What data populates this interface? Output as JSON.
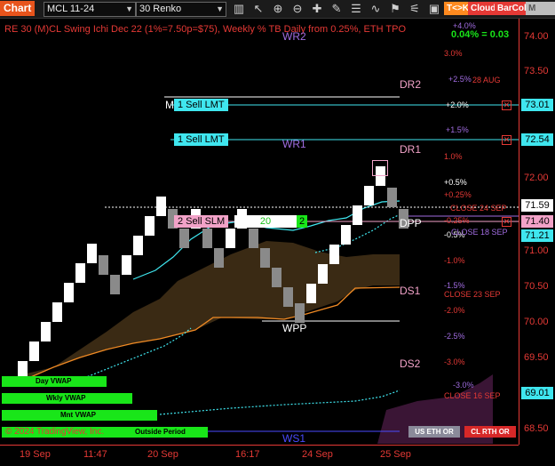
{
  "toolbar": {
    "chart_label": "Chart",
    "instrument": "MCL 11-24",
    "bar_type": "30 Renko",
    "tk_label": "T<>K",
    "cloud_label": "Cloud",
    "barcol_label": "BarCol",
    "mmva_label": "M VWA"
  },
  "header": {
    "title": "RE 30 (M)CL Swing Ichi Dec 22  (1%=7.50p=$75), Weekly % TB Daily from 0.25%, ETH TPO",
    "pct_readout": "0.04% = 0.03"
  },
  "colors": {
    "axis_red": "#e53935",
    "cyan_tag": "#3fe6ef",
    "bull_box": "#ffffff",
    "bear_box": "#8a8a8a",
    "cloud_fill": "#3a2a14",
    "orange_line": "#f08a24",
    "vwap_green": "#19e619",
    "pink_level": "#f2a2c8",
    "purple_level": "#a06ce0"
  },
  "price_axis": {
    "ticks": [
      "74.00",
      "73.50",
      "73.01",
      "72.54",
      "72.00",
      "71.59",
      "71.40",
      "71.21",
      "71.00",
      "70.50",
      "70.00",
      "69.50",
      "69.01",
      "68.50"
    ]
  },
  "price_tags": [
    {
      "value": "73.01",
      "style": "cyan"
    },
    {
      "value": "72.54",
      "style": "cyan"
    },
    {
      "value": "71.59",
      "style": "white"
    },
    {
      "value": "71.40",
      "style": "pink"
    },
    {
      "value": "71.21",
      "style": "cyan"
    },
    {
      "value": "69.01",
      "style": "cyan"
    }
  ],
  "time_axis": [
    "19 Sep",
    "11:47",
    "20 Sep",
    "16:17",
    "24 Sep",
    "25 Sep"
  ],
  "levels": {
    "wr2": "WR2",
    "wr1": "WR1",
    "wpp": "WPP",
    "ws1": "WS1",
    "dr2": "DR2",
    "dr1": "DR1",
    "dpp": "DPP",
    "ds1": "DS1",
    "ds2": "DS2",
    "m": "M"
  },
  "pct_ladder": [
    {
      "text": "+4.0%",
      "color": "#a06ce0"
    },
    {
      "text": "3.0%",
      "color": "#e53935"
    },
    {
      "text": "+2.5%",
      "color": "#a06ce0"
    },
    {
      "text": "+2.0%",
      "color": "#ffffff"
    },
    {
      "text": "+1.5%",
      "color": "#a06ce0"
    },
    {
      "text": "1.0%",
      "color": "#e53935"
    },
    {
      "text": "+0.5%",
      "color": "#ffffff"
    },
    {
      "text": "+0.25%",
      "color": "#e53935"
    },
    {
      "text": "-0.25%",
      "color": "#e53935"
    },
    {
      "text": "-0.5%",
      "color": "#ffffff"
    },
    {
      "text": "-1.0%",
      "color": "#e53935"
    },
    {
      "text": "-1.5%",
      "color": "#a06ce0"
    },
    {
      "text": "-2.0%",
      "color": "#e53935"
    },
    {
      "text": "-2.5%",
      "color": "#a06ce0"
    },
    {
      "text": "-3.0%",
      "color": "#e53935"
    },
    {
      "text": "-3.0%",
      "color": "#a06ce0"
    }
  ],
  "close_labels": [
    "28 AUG",
    "CLOSE 24 SEP",
    "CLOSE 18 SEP",
    "CLOSE 23 SEP",
    "CLOSE 16 SEP"
  ],
  "orders": {
    "sell_lmt_1": "1 Sell LMT",
    "sell_lmt_2": "1 Sell LMT",
    "sell_slm": "2 Sell SLM",
    "qty": "20",
    "qty2": "2"
  },
  "vwap": {
    "day": "Day VWAP",
    "weekly": "Wkly VWAP",
    "monthly": "Mnt VWAP",
    "outside": "Outside Period"
  },
  "footer": {
    "copyright": "© 2024 TradingView, Inc.",
    "us_eth_or": "US ETH OR",
    "cl_rth_or": "CL RTH OR"
  }
}
